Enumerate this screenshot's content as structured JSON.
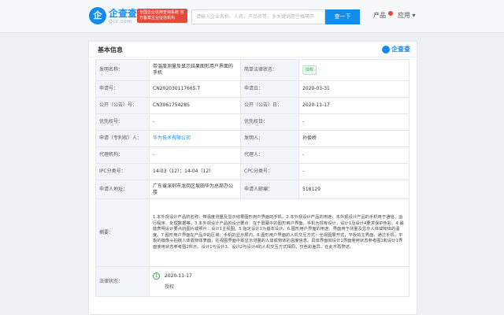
{
  "header": {
    "logo_char": "企",
    "brand": "企查查",
    "brand_sub": "Qcc.com",
    "slogan": "全国企业信用查询系统 官方备案企业征信机构",
    "search_placeholder": "请输入企业名称、人名、产品名等，多关键词用空格隔开",
    "search_button": "查一下",
    "nav_products": "产品",
    "nav_app": "应用"
  },
  "panel": {
    "title": "基本信息",
    "logo_text": "企查查"
  },
  "rows": [
    {
      "l1": "发明名称：",
      "v1": "带温度测量及显示结果图形用户界面的手机",
      "l2": "简单法律状态：",
      "v2": "授权"
    },
    {
      "l1": "申请号：",
      "v1": "CN202030117665.7",
      "l2": "申请日：",
      "v2": "2020-03-31"
    },
    {
      "l1": "公开（公告）号：",
      "v1": "CN306175428S",
      "l2": "公开（公告）日：",
      "v2": "2020-11-17"
    },
    {
      "l1": "优先权号：",
      "v1": "-",
      "l2": "优先权日：",
      "v2": "-"
    },
    {
      "l1": "申请（专利权）人：",
      "v1": "华为技术有限公司",
      "l2": "发明人：",
      "v2": "孙俊桥"
    },
    {
      "l1": "代理机构：",
      "v1": "-",
      "l2": "代理人：",
      "v2": "-"
    },
    {
      "l1": "IPC分类号：",
      "v1": "14-03（12）；14-04（12）",
      "l2": "CPC分类号：",
      "v2": "-"
    },
    {
      "l1": "申请人地址：",
      "v1": "广东省深圳市龙岗区坂田华为总部办公楼",
      "l2": "申请人邮编：",
      "v2": "518129"
    }
  ],
  "abstract": {
    "label": "摘要：",
    "text": "1.本外观设计产品的名称：带温度测量及显示结果图形用户界面的手机。2.本外观设计产品的用途：本外观设计产品的手机用于通信、运行程序、处理数据等。3.本外观设计产品的设计要点：在于屏幕中的图形用户界面。手机为现有设计，设计1及设计4要求保护色彩。4.最能表明设计要点的图片或照片：设计1主视图。5.指定设计1为基本设计。6.图形用户界面的用途：界面用于测量及显示人体或物体的温度。7.图形用户界面在产品中的区域：手机的显示屏内。8.图形用户界面的人机交互方式：全视图展开式，平板的主界面，通过手机、平板的摄像头拍摄人体或物体表面，在视图界面中即显示测量的人体或物体的温度信息。具体界面如设计1界面使用状态参考图1和设计1界面使用状态参考图2所示。设计1与设计3、设计2与设计4的人机交互方式相同，仅色彩差异，在此不再赘述。"
  },
  "legal": {
    "label": "法律状态：",
    "date": "2020-11-17",
    "status": "授权"
  }
}
